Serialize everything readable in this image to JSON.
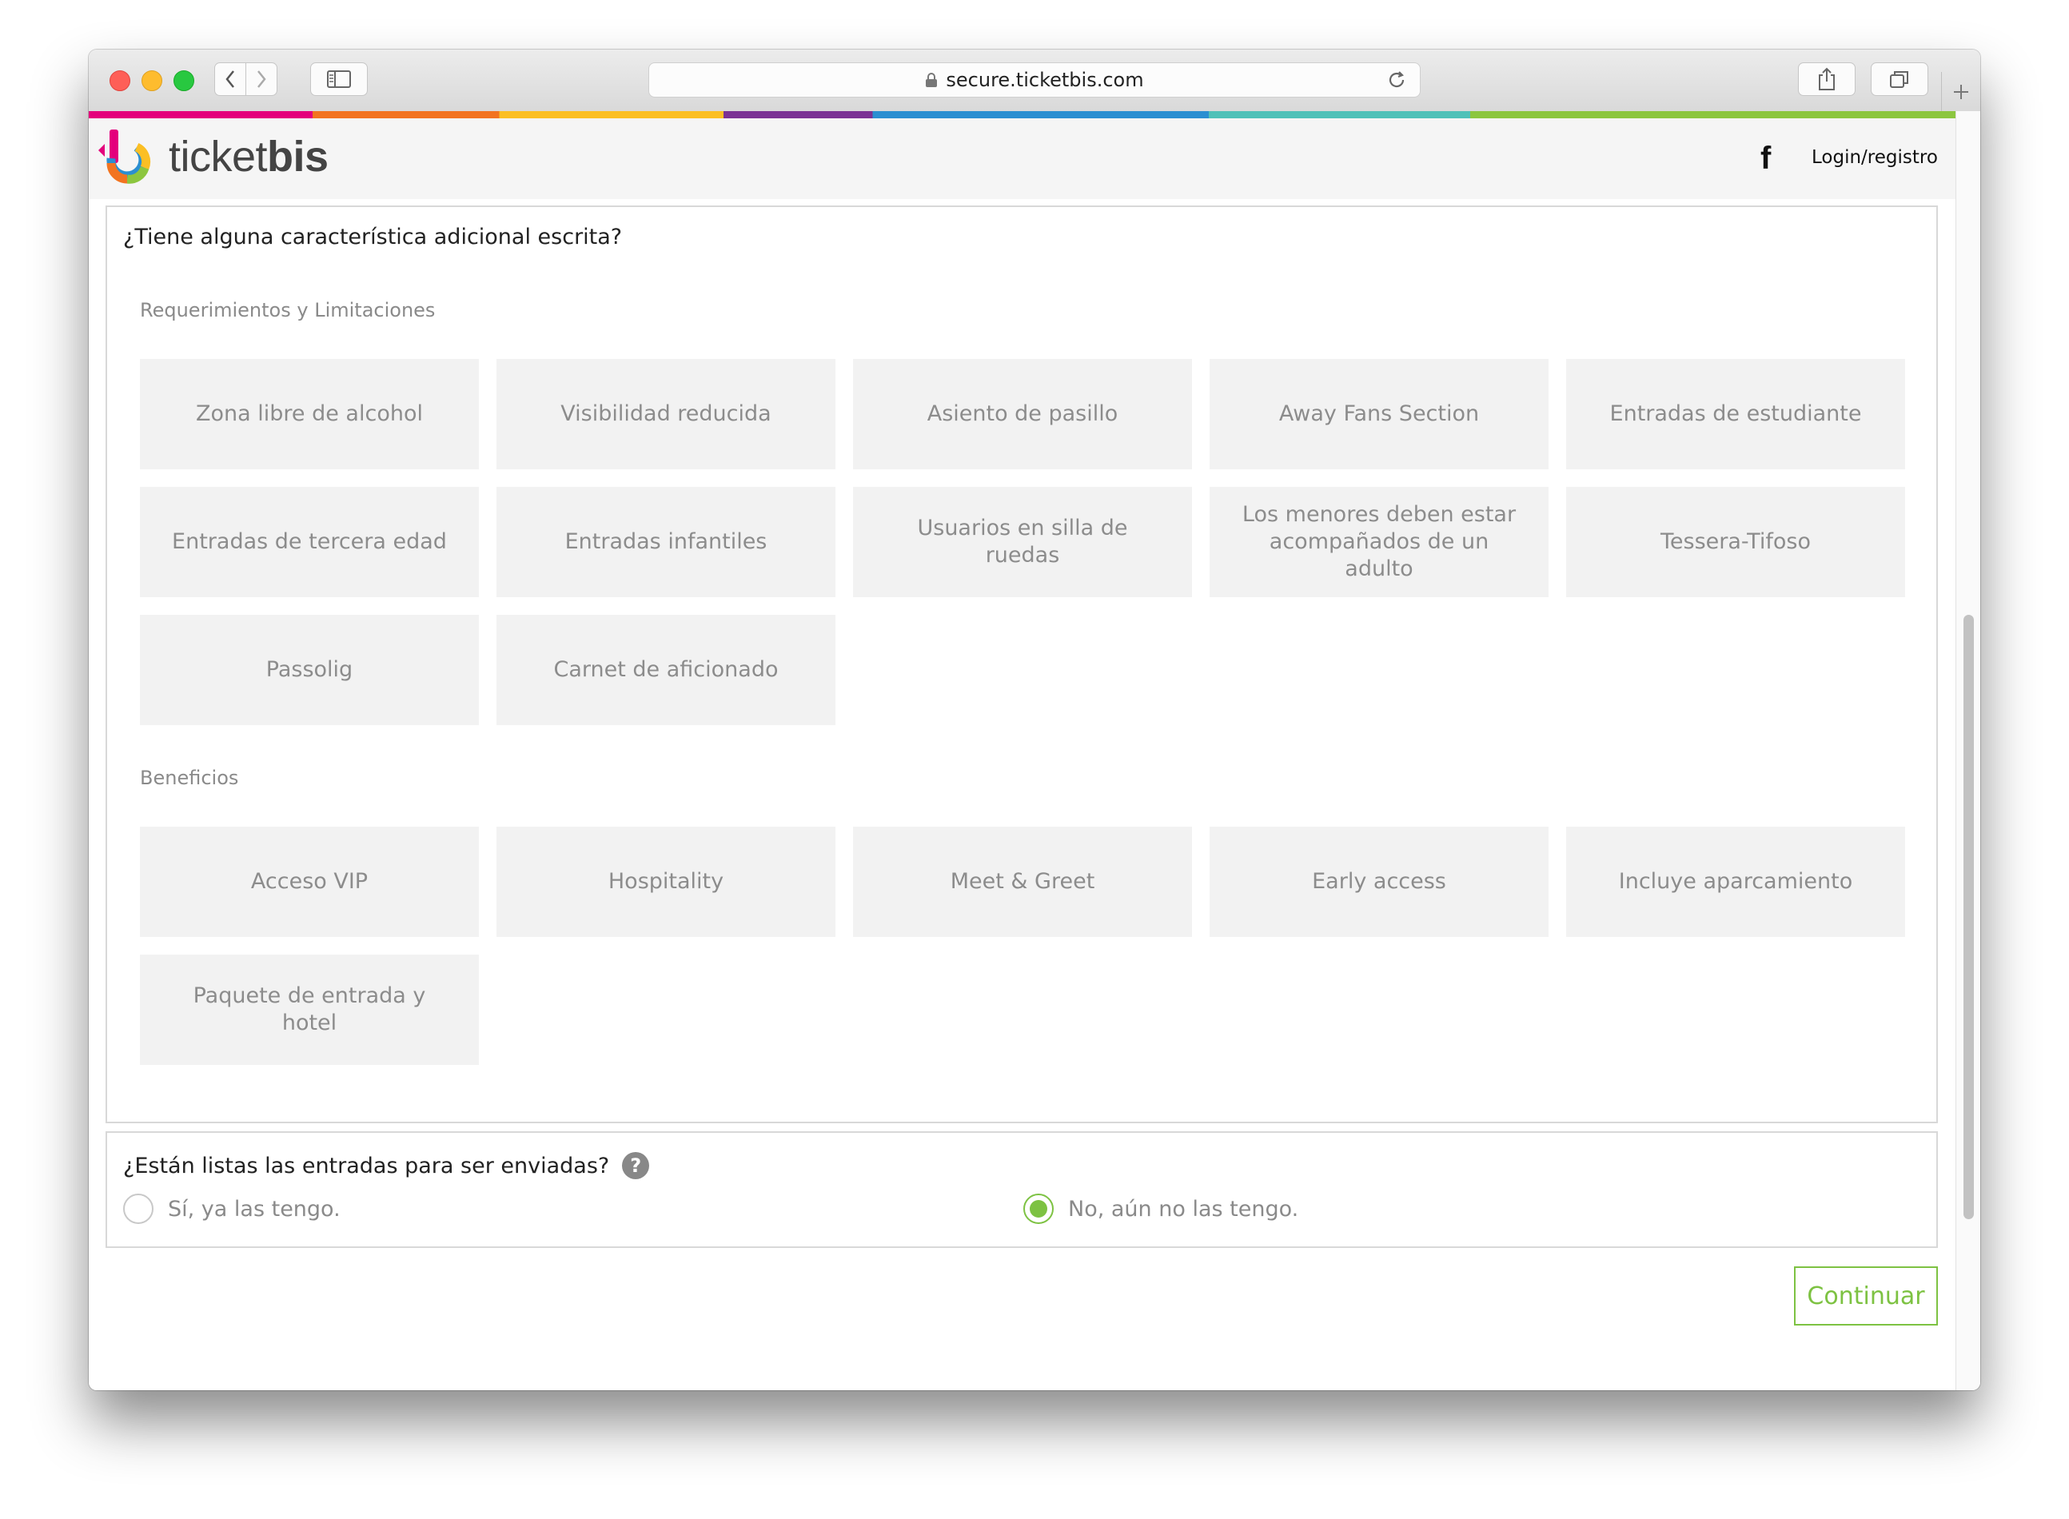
{
  "browser": {
    "url": "secure.ticketbis.com",
    "colors": {
      "red_light": "#fe5f57",
      "yellow_light": "#febc2e",
      "green_light": "#28c840"
    }
  },
  "header": {
    "logo_light": "ticket",
    "logo_bold": "bis",
    "facebook_label": "f",
    "login_label": "Login/registro"
  },
  "features": {
    "question": "¿Tiene alguna característica adicional escrita?",
    "requirements_title": "Requerimientos y Limitaciones",
    "requirements": [
      "Zona libre de alcohol",
      "Visibilidad reducida",
      "Asiento de pasillo",
      "Away Fans Section",
      "Entradas de estudiante",
      "Entradas de tercera edad",
      "Entradas infantiles",
      "Usuarios en silla de ruedas",
      "Los menores deben estar acompañados de un adulto",
      "Tessera-Tifoso",
      "Passolig",
      "Carnet de aficionado"
    ],
    "benefits_title": "Beneficios",
    "benefits": [
      "Acceso VIP",
      "Hospitality",
      "Meet & Greet",
      "Early access",
      "Incluye aparcamiento",
      "Paquete de entrada y hotel"
    ]
  },
  "shipping": {
    "question": "¿Están listas las entradas para ser enviadas?",
    "help_icon": "?",
    "option_yes": "Sí, ya las tengo.",
    "option_no": "No, aún no las tengo.",
    "selected": "no"
  },
  "continue_label": "Continuar",
  "accent_color": "#7dc242"
}
